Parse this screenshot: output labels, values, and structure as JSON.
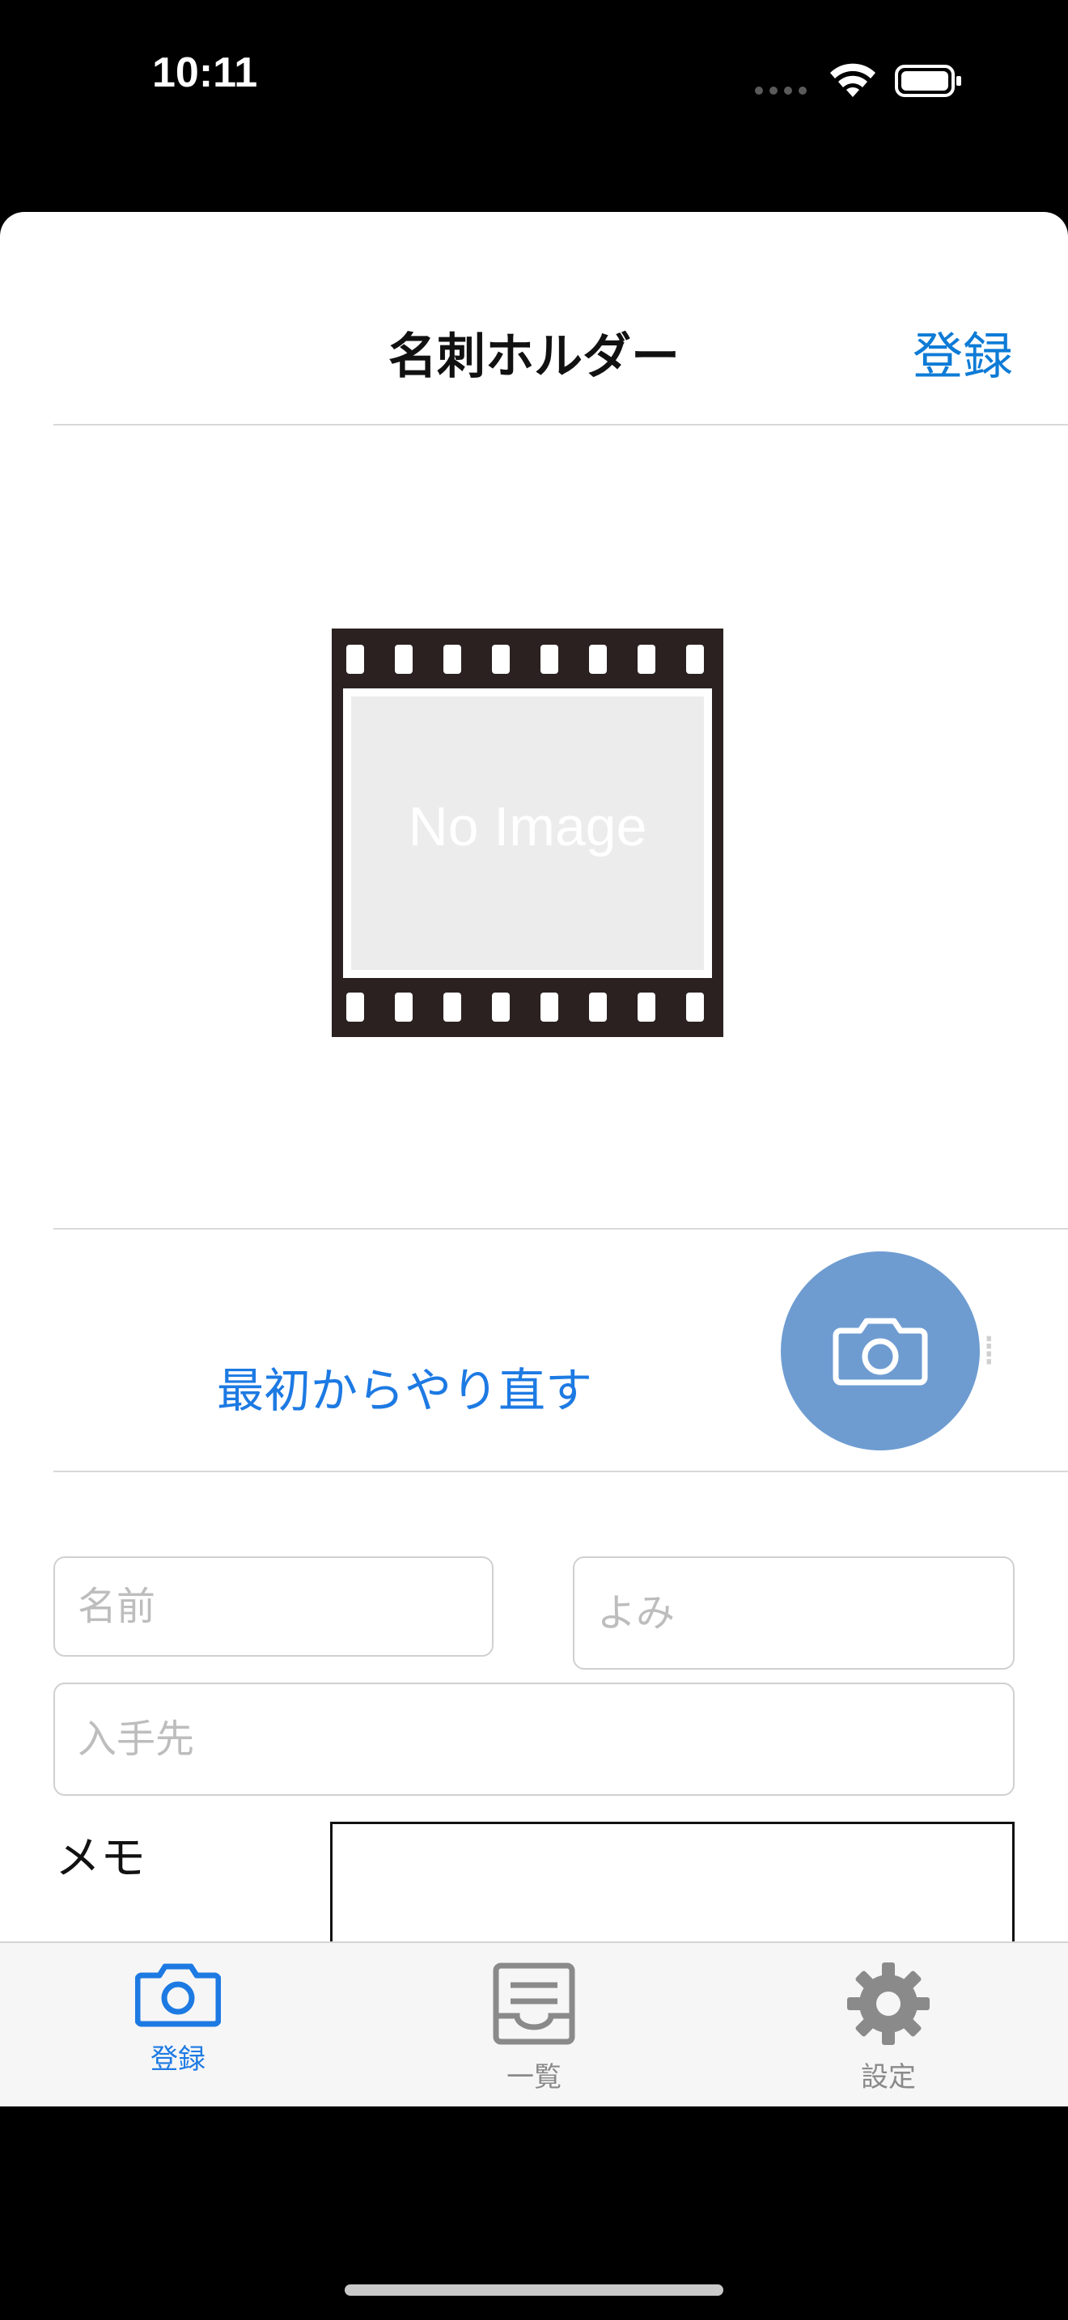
{
  "status": {
    "time": "10:11"
  },
  "header": {
    "title": "名刺ホルダー",
    "action_label": "登録"
  },
  "preview": {
    "placeholder_text": "No Image"
  },
  "actions": {
    "reset_label": "最初からやり直す",
    "camera_icon": "camera-icon"
  },
  "form": {
    "name_placeholder": "名前",
    "reading_placeholder": "よみ",
    "source_placeholder": "入手先",
    "memo_label": "メモ"
  },
  "tabs": [
    {
      "label": "登録",
      "icon": "camera-icon",
      "active": true
    },
    {
      "label": "一覧",
      "icon": "tray-icon",
      "active": false
    },
    {
      "label": "設定",
      "icon": "gear-icon",
      "active": false
    }
  ],
  "colors": {
    "accent": "#1d7ae3",
    "fab": "#6e9cd1",
    "inactive": "#8a8a8a"
  }
}
